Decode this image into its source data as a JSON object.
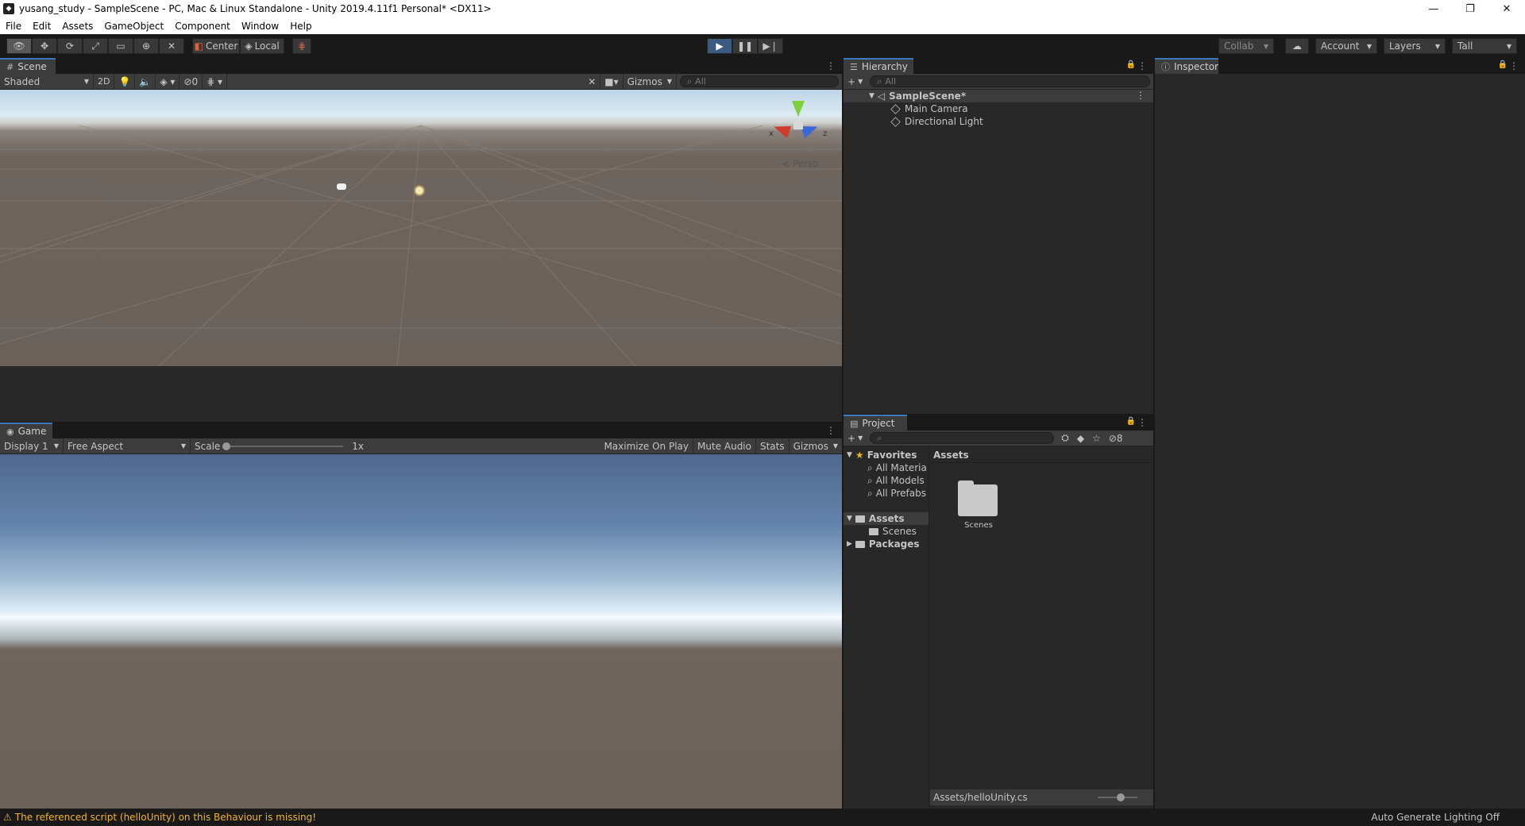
{
  "window": {
    "title": "yusang_study - SampleScene - PC, Mac & Linux Standalone - Unity 2019.4.11f1 Personal* <DX11>",
    "minimize": "—",
    "maximize": "❐",
    "close": "✕"
  },
  "menu": [
    "File",
    "Edit",
    "Assets",
    "GameObject",
    "Component",
    "Window",
    "Help"
  ],
  "toolbar": {
    "pivot": "Center",
    "space": "Local",
    "collab": "Collab",
    "account": "Account",
    "layers": "Layers",
    "layout": "Tall"
  },
  "scene": {
    "tab": "Scene",
    "shading": "Shaded",
    "mode2d": "2D",
    "hidden_count": "0",
    "gizmos": "Gizmos",
    "search_placeholder": "All",
    "persp": "Persp",
    "axis_x": "x",
    "axis_z": "z"
  },
  "game": {
    "tab": "Game",
    "display": "Display 1",
    "aspect": "Free Aspect",
    "scale_label": "Scale",
    "scale_value": "1x",
    "maximize": "Maximize On Play",
    "mute": "Mute Audio",
    "stats": "Stats",
    "gizmos": "Gizmos"
  },
  "hierarchy": {
    "tab": "Hierarchy",
    "search_placeholder": "All",
    "scene_name": "SampleScene*",
    "items": [
      "Main Camera",
      "Directional Light"
    ]
  },
  "inspector": {
    "tab": "Inspector"
  },
  "project": {
    "tab": "Project",
    "hidden_count": "8",
    "favorites": "Favorites",
    "favorite_items": [
      "All Materia",
      "All Models",
      "All Prefabs"
    ],
    "assets": "Assets",
    "asset_children": [
      "Scenes"
    ],
    "packages": "Packages",
    "content_header": "Assets",
    "content_items": [
      "Scenes"
    ],
    "footer_path": "Assets/helloUnity.cs"
  },
  "status": {
    "message": "The referenced script (helloUnity) on this Behaviour is missing!",
    "lighting": "Auto Generate Lighting Off",
    "warn_color": "#f0b429"
  }
}
